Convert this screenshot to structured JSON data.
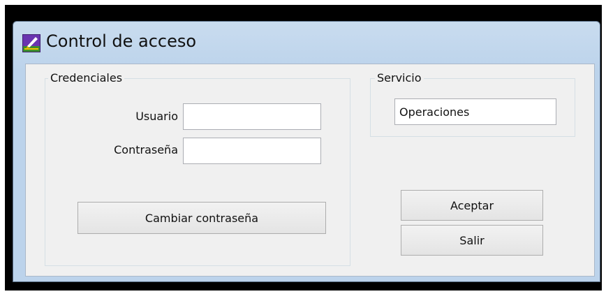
{
  "window": {
    "title": "Control de acceso",
    "icon": "app-pen-icon"
  },
  "credentials": {
    "group_label": "Credenciales",
    "user_label": "Usuario",
    "user_value": "",
    "password_label": "Contraseña",
    "password_value": "",
    "change_password_label": "Cambiar contraseña"
  },
  "service": {
    "group_label": "Servicio",
    "value": "Operaciones"
  },
  "actions": {
    "accept_label": "Aceptar",
    "exit_label": "Salir"
  },
  "colors": {
    "frame": "#bcd3eb",
    "client": "#f0f0f0",
    "icon": "#6a34b0"
  }
}
